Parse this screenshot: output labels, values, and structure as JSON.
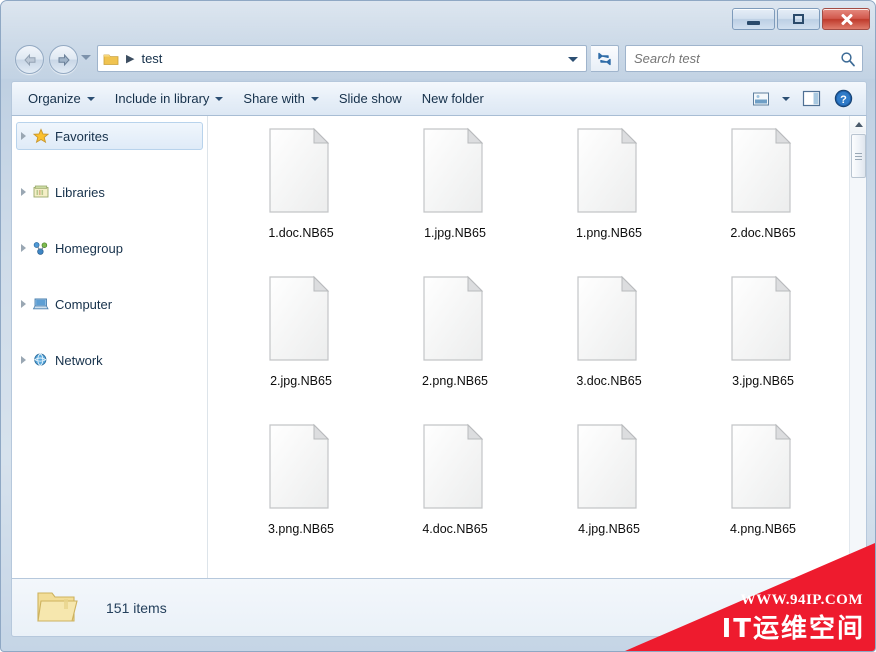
{
  "window": {
    "title": "",
    "caption_buttons": [
      {
        "name": "minimize",
        "label": "Minimize"
      },
      {
        "name": "maximize",
        "label": "Maximize"
      },
      {
        "name": "close",
        "label": "Close"
      }
    ]
  },
  "nav": {
    "back_label": "Back",
    "forward_label": "Forward",
    "recent_label": "Recent pages",
    "refresh_label": "Refresh",
    "breadcrumb_separator": "▶",
    "breadcrumb": "test"
  },
  "search": {
    "placeholder": "Search test",
    "value": "",
    "icon": "search-icon"
  },
  "toolbar": {
    "items": [
      {
        "label": "Organize",
        "has_caret": true
      },
      {
        "label": "Include in library",
        "has_caret": true
      },
      {
        "label": "Share with",
        "has_caret": true
      },
      {
        "label": "Slide show",
        "has_caret": false
      },
      {
        "label": "New folder",
        "has_caret": false
      }
    ],
    "right_icons": [
      {
        "name": "change-view-icon",
        "label": "Change your view"
      },
      {
        "name": "change-view-caret-icon",
        "label": "More view options"
      },
      {
        "name": "preview-pane-icon",
        "label": "Show the preview pane"
      },
      {
        "name": "help-icon",
        "label": "Get help"
      }
    ]
  },
  "sidebar": {
    "items": [
      {
        "label": "Favorites",
        "icon": "star-icon",
        "selected": true
      },
      {
        "label": "Libraries",
        "icon": "libraries-icon",
        "selected": false
      },
      {
        "label": "Homegroup",
        "icon": "homegroup-icon",
        "selected": false
      },
      {
        "label": "Computer",
        "icon": "computer-icon",
        "selected": false
      },
      {
        "label": "Network",
        "icon": "network-icon",
        "selected": false
      }
    ]
  },
  "files": [
    {
      "label": "1.doc.NB65",
      "icon": "blank-document-icon"
    },
    {
      "label": "1.jpg.NB65",
      "icon": "blank-document-icon"
    },
    {
      "label": "1.png.NB65",
      "icon": "blank-document-icon"
    },
    {
      "label": "2.doc.NB65",
      "icon": "blank-document-icon"
    },
    {
      "label": "2.jpg.NB65",
      "icon": "blank-document-icon"
    },
    {
      "label": "2.png.NB65",
      "icon": "blank-document-icon"
    },
    {
      "label": "3.doc.NB65",
      "icon": "blank-document-icon"
    },
    {
      "label": "3.jpg.NB65",
      "icon": "blank-document-icon"
    },
    {
      "label": "3.png.NB65",
      "icon": "blank-document-icon"
    },
    {
      "label": "4.doc.NB65",
      "icon": "blank-document-icon"
    },
    {
      "label": "4.jpg.NB65",
      "icon": "blank-document-icon"
    },
    {
      "label": "4.png.NB65",
      "icon": "blank-document-icon"
    }
  ],
  "status": {
    "item_count_text": "151 items",
    "folder_icon": "folder-icon"
  },
  "scrollbar": {
    "up_arrow": "scroll-up-icon",
    "down_arrow": "scroll-down-icon"
  },
  "watermark": {
    "url": "WWW.94IP.COM",
    "site_name": "IT运维空间",
    "color": "#ee1b2e"
  },
  "colors": {
    "frame": "#cfdce9",
    "accent": "#2c4f73",
    "close_button": "#bf3b2c",
    "selection": "#dfebf8"
  }
}
